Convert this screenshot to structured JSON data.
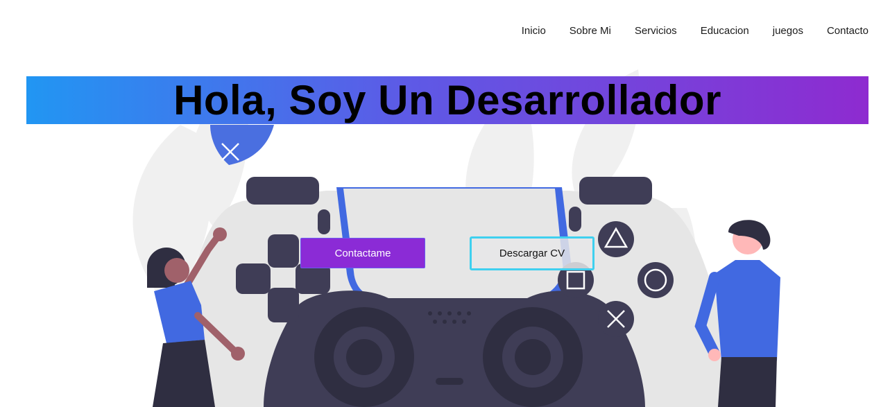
{
  "nav": {
    "items": [
      "Inicio",
      "Sobre Mi",
      "Servicios",
      "Educacion",
      "juegos",
      "Contacto"
    ]
  },
  "hero": {
    "title": "Hola, Soy Un Desarrollador",
    "primary_button": "Contactame",
    "secondary_button": "Descargar CV"
  },
  "colors": {
    "gradient_start": "#2196f3",
    "gradient_end": "#8e2bd0",
    "primary_button_bg": "#8b2bd6",
    "secondary_button_border": "#3fd0ef"
  }
}
